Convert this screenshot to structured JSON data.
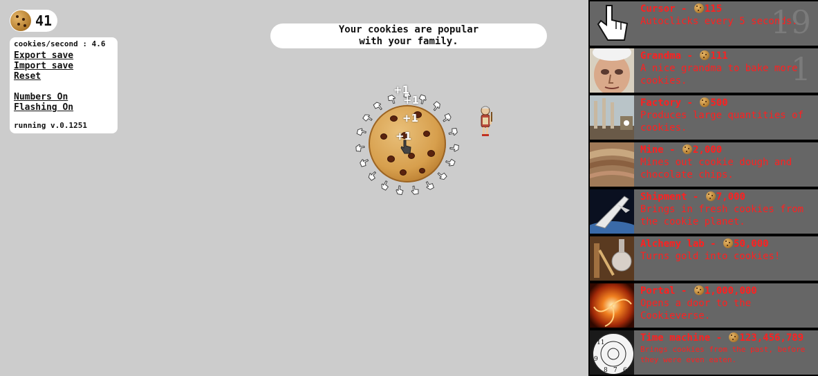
{
  "counter": {
    "value": "41",
    "icon": "cookie-icon"
  },
  "stats": {
    "cps": "cookies/second : 4.6",
    "export_save": "Export save",
    "import_save": "Import save",
    "reset": "Reset",
    "numbers_toggle": "Numbers On",
    "flashing_toggle": "Flashing On",
    "version": "running v.0.1251"
  },
  "news": {
    "message": "Your cookies are popular with your family."
  },
  "floating_text": [
    "+1",
    "+1",
    "+1",
    "+1",
    "+1"
  ],
  "store": {
    "items": [
      {
        "name": "Cursor",
        "price": "115",
        "desc": "Autoclicks every 5 seconds.",
        "count": "19",
        "icon": "cursor-icon"
      },
      {
        "name": "Grandma",
        "price": "111",
        "desc": "A nice grandma to bake more cookies.",
        "count": "1",
        "icon": "grandma-icon"
      },
      {
        "name": "Factory",
        "price": "500",
        "desc": "Produces large quantities of cookies.",
        "count": "",
        "icon": "factory-icon"
      },
      {
        "name": "Mine",
        "price": "2,000",
        "desc": "Mines out cookie dough and chocolate chips.",
        "count": "",
        "icon": "mine-icon"
      },
      {
        "name": "Shipment",
        "price": "7,000",
        "desc": "Brings in fresh cookies from the cookie planet.",
        "count": "",
        "icon": "shipment-icon"
      },
      {
        "name": "Alchemy lab",
        "price": "50,000",
        "desc": "Turns gold into cookies!",
        "count": "",
        "icon": "alchemy-lab-icon"
      },
      {
        "name": "Portal",
        "price": "1,000,000",
        "desc": "Opens a door to the Cookieverse.",
        "count": "",
        "icon": "portal-icon"
      },
      {
        "name": "Time machine",
        "price": "123,456,789",
        "desc": "Brings cookies from the past, before they were even eaten.",
        "count": "",
        "icon": "time-machine-icon"
      }
    ]
  },
  "colors": {
    "background": "#cccccc",
    "store_bg": "#666666",
    "store_text": "#ff2020",
    "panel": "#ffffff"
  }
}
